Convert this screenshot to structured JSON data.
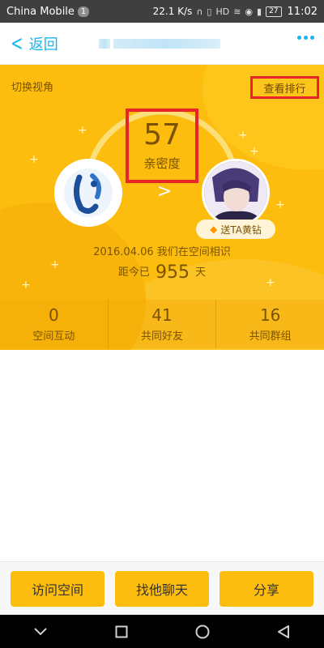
{
  "status_bar": {
    "carrier": "China Mobile",
    "sim_badge": "1",
    "speed": "22.1 K/s",
    "hd_badge": "HD",
    "battery": "27",
    "time": "11:02"
  },
  "nav": {
    "back_label": "返回",
    "title_blurred": true,
    "more_icon": "more-dots-icon",
    "accent_color": "#12b7f5"
  },
  "hero": {
    "background_color": "#fdbd0f",
    "switch_view_label": "切换视角",
    "rank_label": "查看排行",
    "intimacy_score": "57",
    "intimacy_label": "亲密度",
    "arrow_icon": "chevron-right-icon",
    "gift_icon": "diamond-icon",
    "gift_label": "送TA黄钻",
    "meet_text": "2016.04.06 我们在空间相识",
    "days_prefix": "距今已",
    "days_value": "955",
    "days_suffix": "天",
    "highlight_color": "#e8232a"
  },
  "stats": [
    {
      "value": "0",
      "label": "空间互动"
    },
    {
      "value": "41",
      "label": "共同好友"
    },
    {
      "value": "16",
      "label": "共同群组"
    }
  ],
  "actions": {
    "visit_label": "访问空间",
    "chat_label": "找他聊天",
    "share_label": "分享"
  },
  "system_nav": {
    "back_icon": "triangle-back-icon",
    "home_icon": "circle-home-icon",
    "recents_icon": "square-recents-icon"
  }
}
